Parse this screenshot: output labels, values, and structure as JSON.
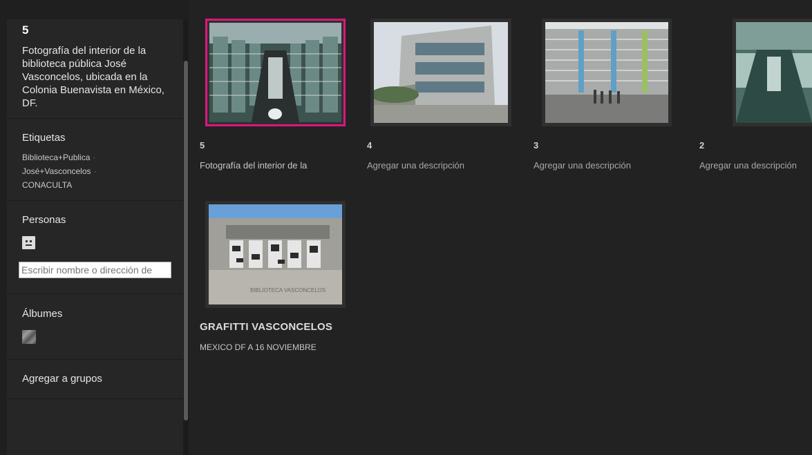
{
  "sidebar": {
    "photo_title": "5",
    "photo_description": "Fotografía del interior de la biblioteca pública José Vasconcelos, ubicada en la Colonia Buenavista en México, DF.",
    "tags_heading": "Etiquetas",
    "tags": [
      "Biblioteca+Publica",
      "José+Vasconcelos",
      "CONACULTA"
    ],
    "tag_separator": "·",
    "people_heading": "Personas",
    "person_input_placeholder": "Escribir nombre o dirección de",
    "albums_heading": "Álbumes",
    "groups_heading": "Agregar a grupos"
  },
  "photos": [
    {
      "title": "5",
      "description": "Fotografía del interior de la",
      "selected": true
    },
    {
      "title": "4",
      "description": "Agregar una descripción",
      "selected": false
    },
    {
      "title": "3",
      "description": "Agregar una descripción",
      "selected": false
    },
    {
      "title": "2",
      "description": "Agregar una descripción",
      "selected": false
    },
    {
      "title": "GRAFITTI VASCONCELOS",
      "description": "MEXICO DF A 16 NOVIEMBRE",
      "selected": false
    }
  ],
  "colors": {
    "selected_border": "#e0157c",
    "background": "#222222",
    "sidebar": "#262626"
  }
}
